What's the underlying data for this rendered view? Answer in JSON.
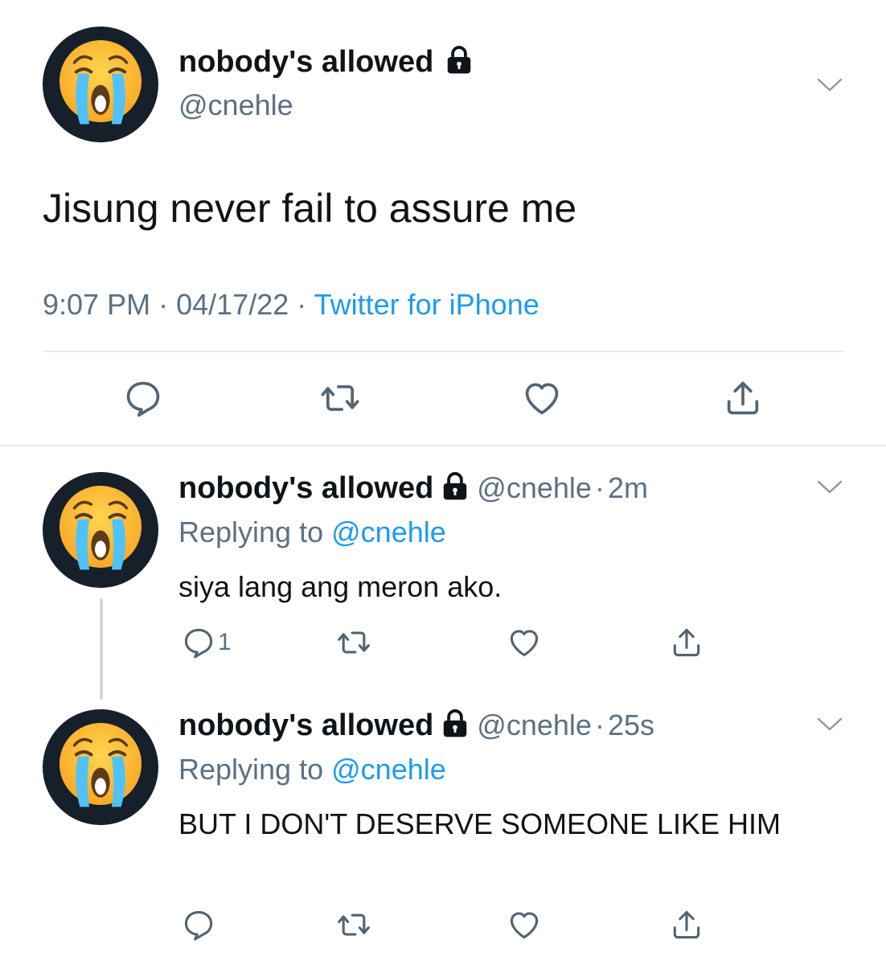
{
  "main_tweet": {
    "display_name": "nobody's allowed",
    "handle": "@cnehle",
    "text": "Jisung never fail to assure me",
    "time": "9:07 PM",
    "sep1": "·",
    "date": "04/17/22",
    "sep2": "·",
    "source": "Twitter for iPhone"
  },
  "replies": [
    {
      "display_name": "nobody's allowed",
      "handle": "@cnehle",
      "sep": "·",
      "age": "2m",
      "replying_prefix": "Replying to",
      "replying_handle": "@cnehle",
      "text": "siya lang ang meron ako.",
      "reply_count": "1"
    },
    {
      "display_name": "nobody's allowed",
      "handle": "@cnehle",
      "sep": "·",
      "age": "25s",
      "replying_prefix": "Replying to",
      "replying_handle": "@cnehle",
      "text": "BUT I DON'T DESERVE SOMEONE LIKE HIM",
      "reply_count": ""
    }
  ],
  "icons": {
    "avatar": "loudly-crying-face-emoji",
    "lock": "lock-icon",
    "menu": "chevron-down-icon",
    "reply": "reply-icon",
    "retweet": "retweet-icon",
    "like": "heart-icon",
    "share": "share-icon"
  },
  "colors": {
    "link": "#1d9bf0",
    "secondary_text": "#5b7083",
    "primary_text": "#0f1419",
    "avatar_bg": "#15202b"
  }
}
